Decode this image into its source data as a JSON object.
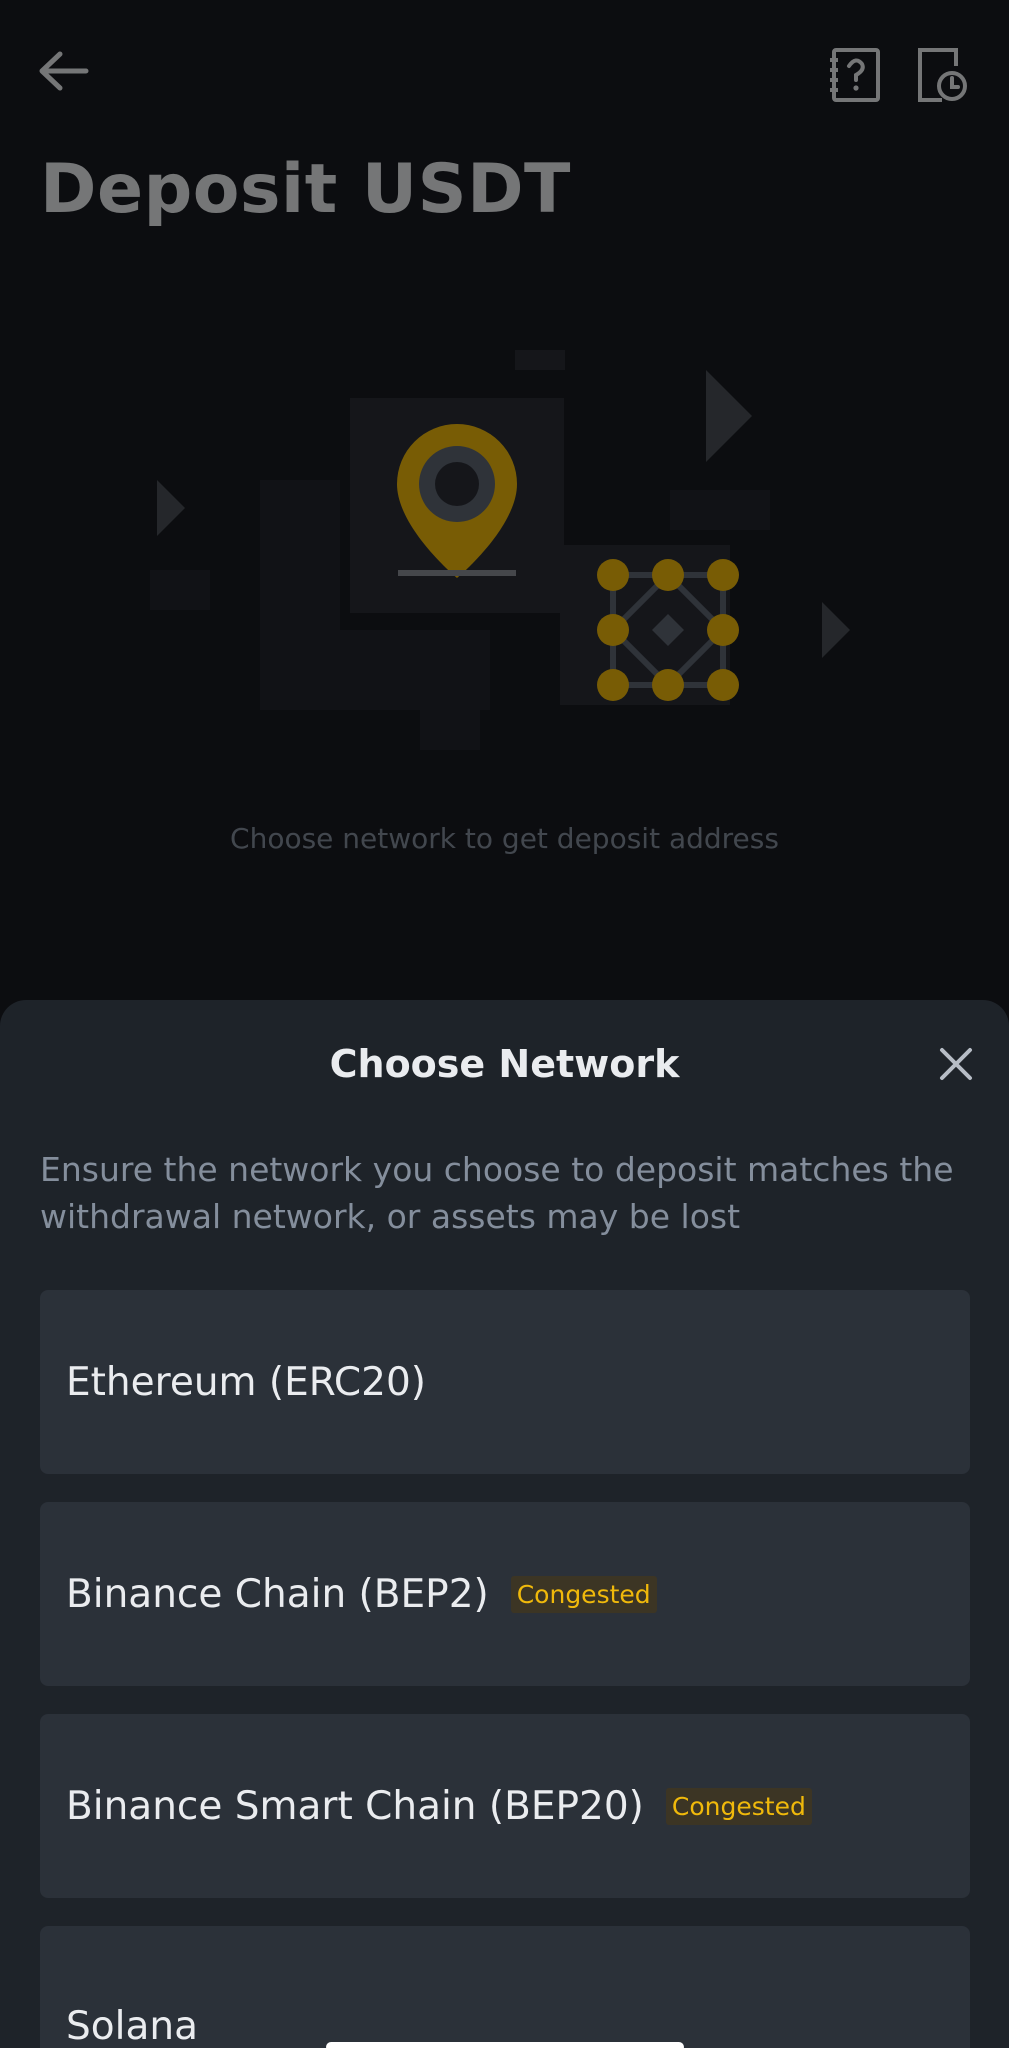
{
  "header": {
    "title": "Deposit USDT",
    "back_icon": "arrow-left-icon",
    "help_icon": "help-document-icon",
    "history_icon": "history-clock-icon"
  },
  "illustration": {
    "icon": "location-pin-and-network-icon",
    "accent_color": "#f0b90b"
  },
  "hint_text": "Choose network to get deposit address",
  "sheet": {
    "title": "Choose Network",
    "close_icon": "close-icon",
    "description": "Ensure the network you choose to deposit matches the withdrawal network, or assets may be lost",
    "networks": [
      {
        "name": "Ethereum (ERC20)",
        "badge": ""
      },
      {
        "name": "Binance Chain (BEP2)",
        "badge": "Congested"
      },
      {
        "name": "Binance Smart Chain (BEP20)",
        "badge": "Congested"
      },
      {
        "name": "Solana",
        "badge": ""
      }
    ]
  },
  "colors": {
    "background": "#181a20",
    "sheet": "#1e2329",
    "card": "#2b3139",
    "accent": "#f0b90b",
    "text_primary": "#eaecef",
    "text_secondary": "#848e9c"
  }
}
